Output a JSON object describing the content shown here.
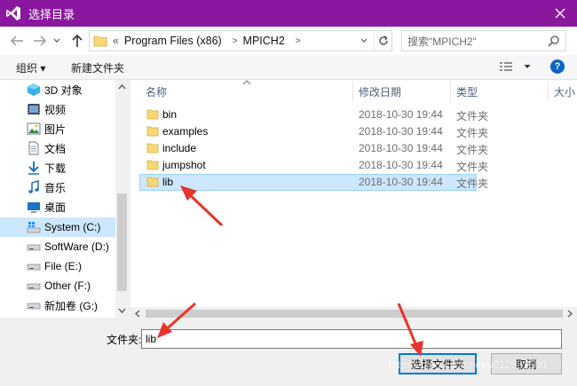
{
  "window": {
    "title": "选择目录"
  },
  "address": {
    "overflow": "«",
    "segments": [
      "Program Files (x86)",
      "MPICH2"
    ]
  },
  "search": {
    "placeholder": "搜索\"MPICH2\""
  },
  "toolbar": {
    "organize": "组织 ▾",
    "new_folder": "新建文件夹",
    "help": "?"
  },
  "sidebar": {
    "items": [
      {
        "label": "3D 对象",
        "icon": "3d-objects-icon"
      },
      {
        "label": "视频",
        "icon": "video-icon"
      },
      {
        "label": "图片",
        "icon": "pictures-icon"
      },
      {
        "label": "文档",
        "icon": "documents-icon"
      },
      {
        "label": "下载",
        "icon": "download-icon"
      },
      {
        "label": "音乐",
        "icon": "music-icon"
      },
      {
        "label": "桌面",
        "icon": "desktop-icon"
      },
      {
        "label": "System (C:)",
        "icon": "system-drive-icon",
        "selected": true
      },
      {
        "label": "SoftWare (D:)",
        "icon": "drive-icon"
      },
      {
        "label": "File (E:)",
        "icon": "drive-icon"
      },
      {
        "label": "Other (F:)",
        "icon": "drive-icon"
      },
      {
        "label": "新加卷 (G:)",
        "icon": "drive-icon"
      }
    ]
  },
  "columns": {
    "name": "名称",
    "modified": "修改日期",
    "type": "类型",
    "size": "大小"
  },
  "files": [
    {
      "name": "bin",
      "modified": "2018-10-30 19:44",
      "type": "文件夹"
    },
    {
      "name": "examples",
      "modified": "2018-10-30 19:44",
      "type": "文件夹"
    },
    {
      "name": "include",
      "modified": "2018-10-30 19:44",
      "type": "文件夹"
    },
    {
      "name": "jumpshot",
      "modified": "2018-10-30 19:44",
      "type": "文件夹"
    },
    {
      "name": "lib",
      "modified": "2018-10-30 19:44",
      "type": "文件夹",
      "selected": true
    }
  ],
  "folder_field": {
    "label": "文件夹:",
    "value": "lib"
  },
  "buttons": {
    "select": "选择文件夹",
    "cancel": "取消"
  },
  "watermark": "https://blog.csdn.net/u012532500",
  "colors": {
    "titlebar": "#8a189e",
    "selection": "#cce8ff",
    "annotation_arrow": "#e8342c",
    "folder_icon": "#f8d775"
  }
}
